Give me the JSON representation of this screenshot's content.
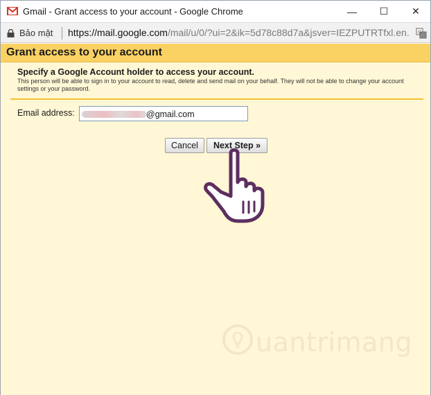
{
  "window": {
    "title": "Gmail - Grant access to your account - Google Chrome",
    "minimize_glyph": "—",
    "maximize_glyph": "☐",
    "close_glyph": "✕"
  },
  "addressbar": {
    "security_label": "Bảo mật",
    "url_host": "https://mail.google.com",
    "url_path": "/mail/u/0/?ui=2&ik=5d78c88d7a&jsver=IEZPUTRTfxl.en."
  },
  "page": {
    "title": "Grant access to your account",
    "subtitle": "Specify a Google Account holder to access your account.",
    "description": "This person will be able to sign in to your account to read, delete and send mail on your behalf. They will not be able to change your account settings or your password.",
    "email_label": "Email address:",
    "email_domain": "@gmail.com",
    "cancel_label": "Cancel",
    "next_label": "Next Step »"
  },
  "watermark": {
    "text": "uantrimang"
  },
  "colors": {
    "header_bar": "#fad163",
    "page_background": "#fff7d6",
    "rule": "#f1c232",
    "gmail_red": "#d93025"
  }
}
